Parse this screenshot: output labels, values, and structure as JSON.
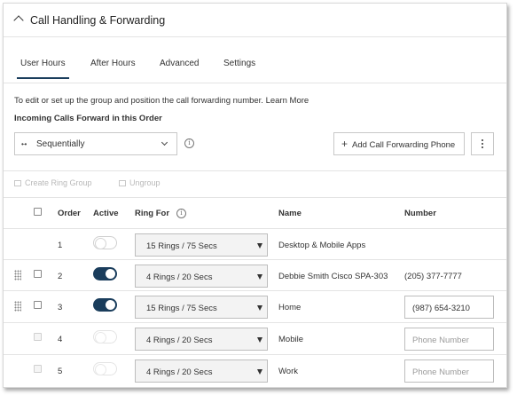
{
  "header": {
    "title": "Call Handling & Forwarding"
  },
  "tabs": [
    {
      "label": "User Hours",
      "active": true
    },
    {
      "label": "After Hours",
      "active": false
    },
    {
      "label": "Advanced",
      "active": false
    },
    {
      "label": "Settings",
      "active": false
    }
  ],
  "help_text": "To edit or set up the group and position the call forwarding number.",
  "learn_more": "Learn More",
  "section_label": "Incoming Calls Forward in this Order",
  "order_select": {
    "value": "Sequentially",
    "icon": "sequential-icon"
  },
  "add_button": "Add Call Forwarding Phone",
  "group_actions": {
    "create": "Create Ring Group",
    "ungroup": "Ungroup"
  },
  "columns": {
    "order": "Order",
    "active": "Active",
    "ring_for": "Ring For",
    "name": "Name",
    "number": "Number"
  },
  "rows": [
    {
      "order": "1",
      "active": false,
      "ring_for": "15 Rings / 75 Secs",
      "name": "Desktop & Mobile Apps",
      "number": "",
      "number_placeholder": ""
    },
    {
      "order": "2",
      "active": true,
      "ring_for": "4 Rings / 20 Secs",
      "name": "Debbie Smith Cisco SPA-303",
      "number": "(205) 377-7777",
      "number_placeholder": ""
    },
    {
      "order": "3",
      "active": true,
      "ring_for": "15 Rings / 75 Secs",
      "name": "Home",
      "number": "(987) 654-3210",
      "number_placeholder": ""
    },
    {
      "order": "4",
      "active": false,
      "ring_for": "4 Rings / 20 Secs",
      "name": "Mobile",
      "number": "",
      "number_placeholder": "Phone Number"
    },
    {
      "order": "5",
      "active": false,
      "ring_for": "4 Rings / 20 Secs",
      "name": "Work",
      "number": "",
      "number_placeholder": "Phone Number"
    }
  ],
  "colors": {
    "accent": "#1a3d5c",
    "border": "#d7d7d7",
    "muted": "#b9b9b9"
  }
}
